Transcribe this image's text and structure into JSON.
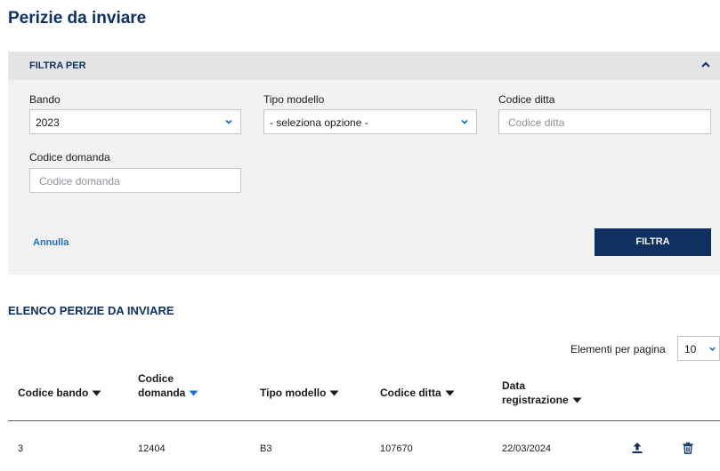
{
  "page": {
    "title": "Perizie da inviare"
  },
  "filter": {
    "header": "FILTRA PER",
    "bando": {
      "label": "Bando",
      "value": "2023"
    },
    "tipo_modello": {
      "label": "Tipo modello",
      "value": "- seleziona opzione -"
    },
    "codice_ditta": {
      "label": "Codice ditta",
      "placeholder": "Codice ditta"
    },
    "codice_domanda": {
      "label": "Codice domanda",
      "placeholder": "Codice domanda"
    },
    "cancel_label": "Annulla",
    "submit_label": "FILTRA"
  },
  "list": {
    "title": "ELENCO PERIZIE DA INVIARE",
    "per_page": {
      "label": "Elementi per pagina",
      "value": "10"
    },
    "columns": [
      {
        "line1": "Codice bando",
        "line2": ""
      },
      {
        "line1": "Codice",
        "line2": "domanda"
      },
      {
        "line1": "Tipo modello",
        "line2": ""
      },
      {
        "line1": "Codice ditta",
        "line2": ""
      },
      {
        "line1": "Data",
        "line2": "registrazione"
      }
    ],
    "rows": [
      {
        "codice_bando": "3",
        "codice_domanda": "12404",
        "tipo_modello": "B3",
        "codice_ditta": "107670",
        "data_registrazione": "22/03/2024"
      }
    ]
  },
  "colors": {
    "primary": "#0e3161",
    "link": "#1e6ec8",
    "panel_bg": "#f2f2f3",
    "panel_header_bg": "#e3e4e6"
  },
  "icons": {
    "collapse": "chevron-up-icon",
    "select": "chevron-down-icon",
    "sort": "caret-down-icon",
    "upload": "upload-icon",
    "delete": "trash-icon"
  }
}
